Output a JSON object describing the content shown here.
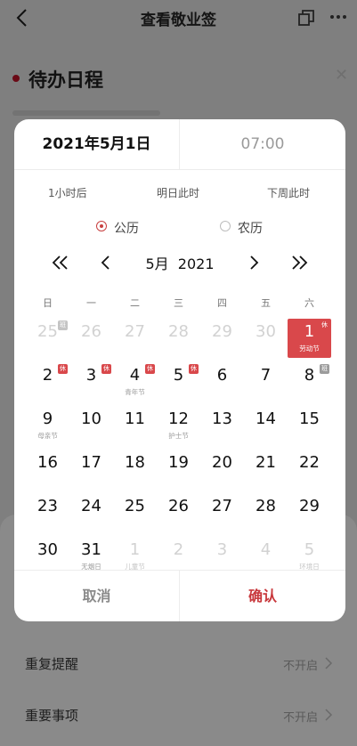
{
  "page": {
    "title": "查看敬业签",
    "heading": "待办日程",
    "rows": [
      {
        "label": "重复提醒",
        "value": "不开启"
      },
      {
        "label": "重要事项",
        "value": "不开启"
      }
    ]
  },
  "dialog": {
    "date": "2021年5月1日",
    "time": "07:00",
    "quick": [
      "1小时后",
      "明日此时",
      "下周此时"
    ],
    "calendar_types": [
      "公历",
      "农历"
    ],
    "month_label": "5月  2021",
    "weekdays": [
      "日",
      "一",
      "二",
      "三",
      "四",
      "五",
      "六"
    ],
    "days": [
      {
        "day": "25",
        "other": true,
        "badge": "班",
        "badge_style": "light"
      },
      {
        "day": "26",
        "other": true
      },
      {
        "day": "27",
        "other": true
      },
      {
        "day": "28",
        "other": true
      },
      {
        "day": "29",
        "other": true
      },
      {
        "day": "30",
        "other": true
      },
      {
        "day": "1",
        "sub": "劳动节",
        "badge": "休",
        "selected": true
      },
      {
        "day": "2",
        "badge": "休"
      },
      {
        "day": "3",
        "badge": "休"
      },
      {
        "day": "4",
        "sub": "青年节",
        "badge": "休"
      },
      {
        "day": "5",
        "badge": "休"
      },
      {
        "day": "6"
      },
      {
        "day": "7"
      },
      {
        "day": "8",
        "badge": "班",
        "badge_style": "ban"
      },
      {
        "day": "9",
        "sub": "母亲节"
      },
      {
        "day": "10"
      },
      {
        "day": "11"
      },
      {
        "day": "12",
        "sub": "护士节"
      },
      {
        "day": "13"
      },
      {
        "day": "14"
      },
      {
        "day": "15"
      },
      {
        "day": "16"
      },
      {
        "day": "17"
      },
      {
        "day": "18"
      },
      {
        "day": "19"
      },
      {
        "day": "20"
      },
      {
        "day": "21"
      },
      {
        "day": "22"
      },
      {
        "day": "23"
      },
      {
        "day": "24"
      },
      {
        "day": "25"
      },
      {
        "day": "26"
      },
      {
        "day": "27"
      },
      {
        "day": "28"
      },
      {
        "day": "29"
      },
      {
        "day": "30"
      },
      {
        "day": "31",
        "sub": "无烟日"
      },
      {
        "day": "1",
        "sub": "儿童节",
        "other": true
      },
      {
        "day": "2",
        "other": true
      },
      {
        "day": "3",
        "other": true
      },
      {
        "day": "4",
        "other": true
      },
      {
        "day": "5",
        "sub": "环境日",
        "other": true
      }
    ],
    "cancel": "取消",
    "confirm": "确认"
  },
  "colors": {
    "accent": "#d9484b",
    "confirm_text": "#c8383c",
    "overlay": "#7f7f7f"
  },
  "icons": [
    "back-icon",
    "copy-icon",
    "more-icon",
    "close-icon",
    "double-chevron-left-icon",
    "chevron-left-icon",
    "chevron-right-icon",
    "double-chevron-right-icon",
    "chevron-right-icon"
  ]
}
